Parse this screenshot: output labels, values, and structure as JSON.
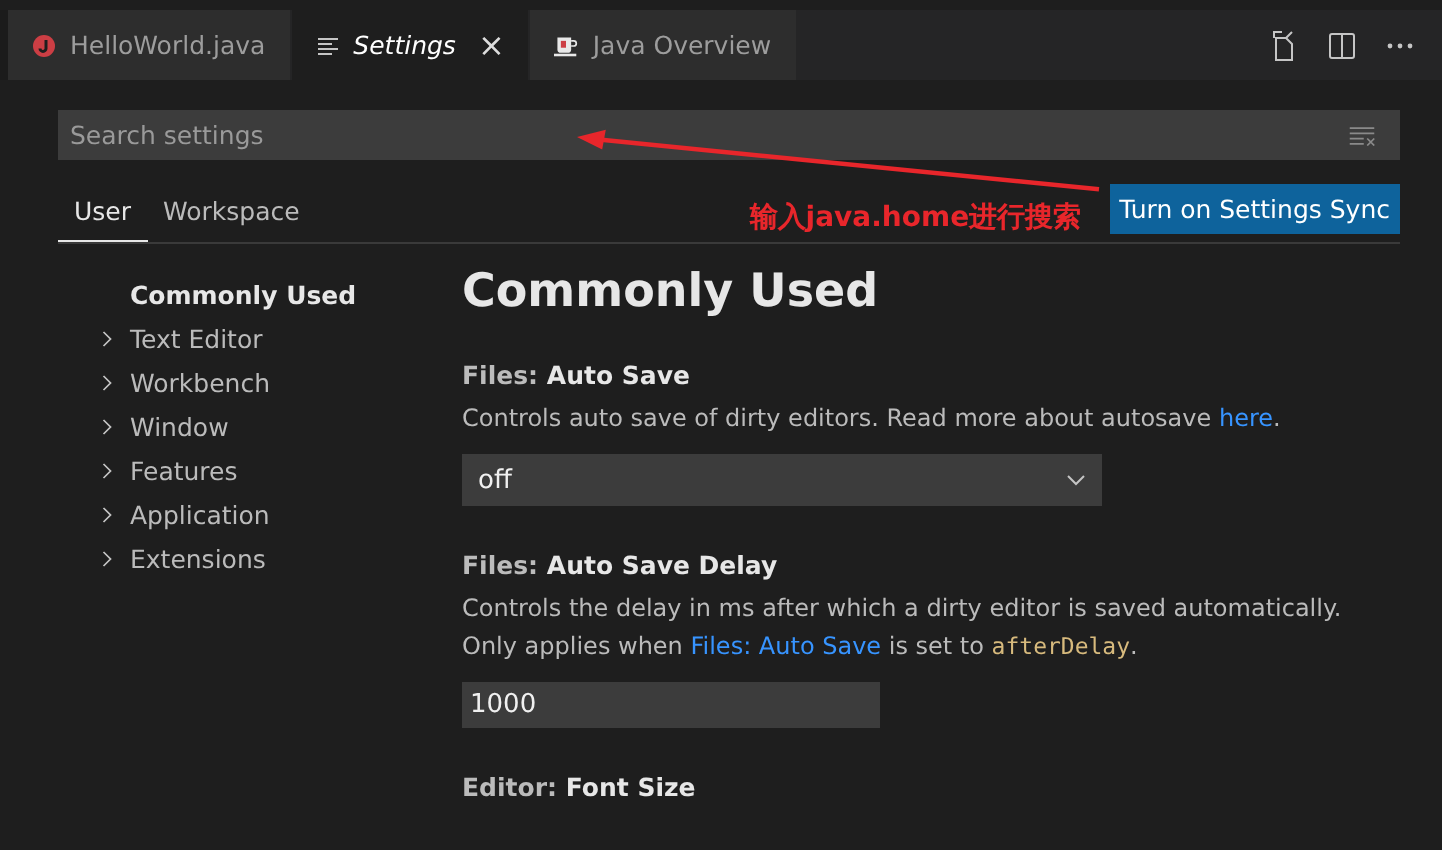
{
  "tabs": [
    {
      "label": "HelloWorld.java",
      "kind": "java",
      "selected": false
    },
    {
      "label": "Settings",
      "kind": "settings",
      "selected": true,
      "close": "×"
    },
    {
      "label": "Java Overview",
      "kind": "overview",
      "selected": false
    }
  ],
  "search": {
    "placeholder": "Search settings"
  },
  "scope_tabs": [
    {
      "label": "User",
      "selected": true
    },
    {
      "label": "Workspace",
      "selected": false
    }
  ],
  "annotation": "输入java.home进行搜索",
  "sync_button": "Turn on Settings Sync",
  "nav": [
    {
      "label": "Commonly Used",
      "selected": true,
      "expandable": false
    },
    {
      "label": "Text Editor",
      "selected": false,
      "expandable": true
    },
    {
      "label": "Workbench",
      "selected": false,
      "expandable": true
    },
    {
      "label": "Window",
      "selected": false,
      "expandable": true
    },
    {
      "label": "Features",
      "selected": false,
      "expandable": true
    },
    {
      "label": "Application",
      "selected": false,
      "expandable": true
    },
    {
      "label": "Extensions",
      "selected": false,
      "expandable": true
    }
  ],
  "heading": "Commonly Used",
  "settings": [
    {
      "category": "Files: ",
      "title": "Auto Save",
      "kind": "dropdown",
      "value": "off",
      "description": [
        {
          "kind": "text",
          "text": "Controls auto save of dirty editors. Read more about autosave "
        },
        {
          "kind": "link",
          "text": "here"
        },
        {
          "kind": "text",
          "text": "."
        }
      ]
    },
    {
      "category": "Files: ",
      "title": "Auto Save Delay",
      "kind": "input",
      "value": "1000",
      "description": [
        {
          "kind": "text",
          "text": "Controls the delay in ms after which a dirty editor is saved automatically. Only applies when "
        },
        {
          "kind": "link",
          "text": "Files: Auto Save"
        },
        {
          "kind": "text",
          "text": " is set to "
        },
        {
          "kind": "code",
          "text": "afterDelay"
        },
        {
          "kind": "text",
          "text": "."
        }
      ]
    },
    {
      "category": "Editor: ",
      "title": "Font Size",
      "kind": "heading-only"
    }
  ]
}
